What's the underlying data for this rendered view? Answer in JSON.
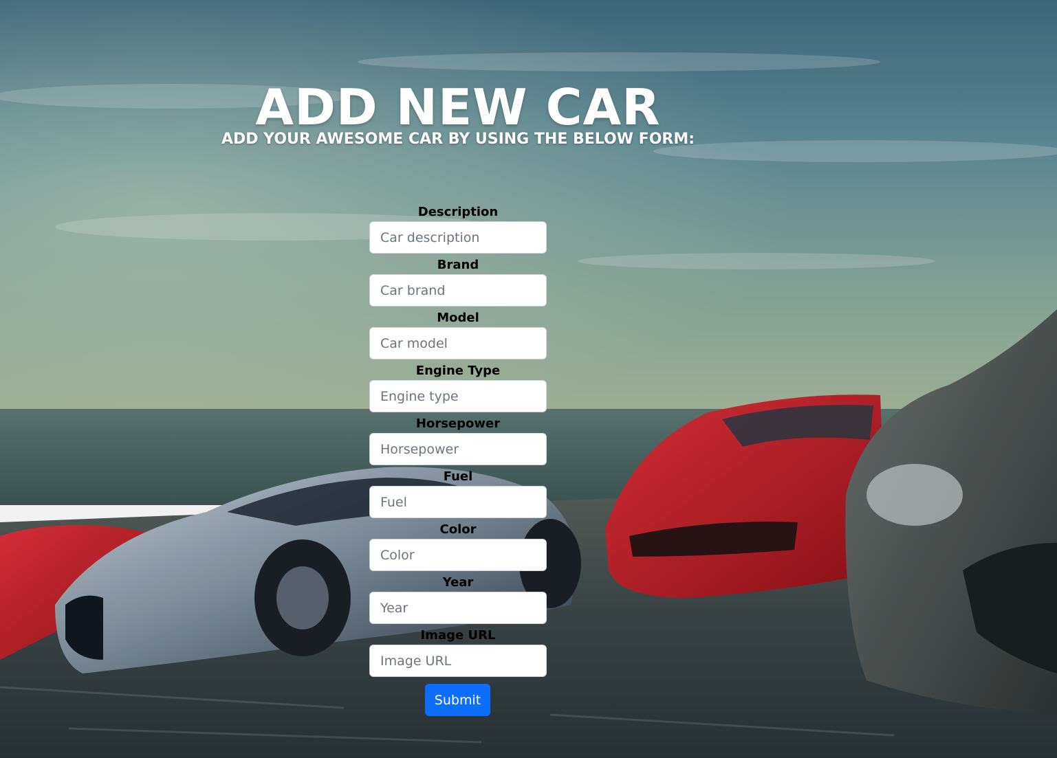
{
  "page": {
    "title": "ADD NEW CAR",
    "subtitle": "ADD YOUR AWESOME CAR BY USING THE BELOW FORM:"
  },
  "background": {
    "scene": "sports-cars-on-coastal-road",
    "sky_color": "#4f7f90",
    "horizon_color": "#9fb39c",
    "sea_color": "#4c6764",
    "road_color": "#3a4648",
    "car_colors": [
      "#c8202a",
      "#5a6a78",
      "#b51d25",
      "#4d5352"
    ]
  },
  "form": {
    "fields": [
      {
        "label": "Description",
        "placeholder": "Car description",
        "value": ""
      },
      {
        "label": "Brand",
        "placeholder": "Car brand",
        "value": ""
      },
      {
        "label": "Model",
        "placeholder": "Car model",
        "value": ""
      },
      {
        "label": "Engine Type",
        "placeholder": "Engine type",
        "value": ""
      },
      {
        "label": "Horsepower",
        "placeholder": "Horsepower",
        "value": ""
      },
      {
        "label": "Fuel",
        "placeholder": "Fuel",
        "value": ""
      },
      {
        "label": "Color",
        "placeholder": "Color",
        "value": ""
      },
      {
        "label": "Year",
        "placeholder": "Year",
        "value": ""
      },
      {
        "label": "Image URL",
        "placeholder": "Image URL",
        "value": ""
      }
    ],
    "submit_label": "Submit",
    "submit_color": "#0d6efd"
  }
}
